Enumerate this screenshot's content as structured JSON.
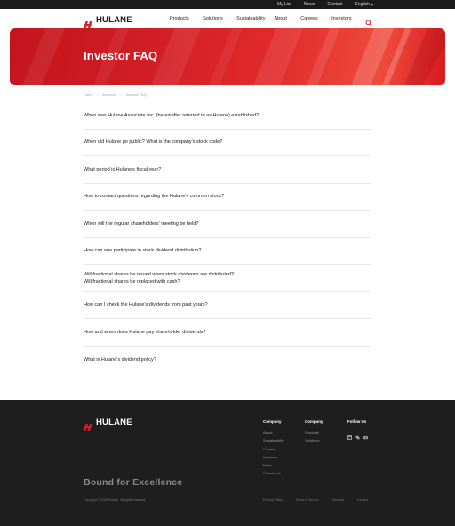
{
  "topbar": {
    "links": [
      "My List",
      "News",
      "Contact"
    ],
    "language": "English"
  },
  "brand": {
    "name": "HULANE",
    "accent": "#d31f25"
  },
  "nav": {
    "items": [
      {
        "label": "Products",
        "has_dropdown": true
      },
      {
        "label": "Solutions",
        "has_dropdown": true
      },
      {
        "label": "Sustainability",
        "has_dropdown": false
      },
      {
        "label": "About",
        "has_dropdown": true
      },
      {
        "label": "Careers",
        "has_dropdown": true
      },
      {
        "label": "Investors",
        "has_dropdown": true
      }
    ],
    "search_icon": "search-icon"
  },
  "hero": {
    "title": "Investor FAQ"
  },
  "breadcrumb": [
    "Home",
    "Investors",
    "Investor FAQ"
  ],
  "faq": [
    "When was Hulane Associate Inc. (hereinafter referred to as Hulane) established?",
    "When did Hulane go public? What is the company's stock code?",
    "What period is Hulane's fiscal year?",
    "How to contact questions regarding the Hulane's common stock?",
    "When will the regular shareholders' meeting be held?",
    "How can one participate in stock dividend distribution?",
    "Will fractional shares be issued when stock dividends are distributed?\nWill fractional shares be replaced with cash?",
    "How can I check the Hulane's dividends from past years?",
    "How and when does Hulane pay shareholder dividends?",
    "What is Hulane's dividend policy?"
  ],
  "footer": {
    "col1": {
      "title": "Company",
      "links": [
        "About",
        "Sustainability",
        "Careers",
        "Investors",
        "News",
        "Contact Us"
      ]
    },
    "col2": {
      "title": "Company",
      "links": [
        "Products",
        "Solutions"
      ]
    },
    "col3": {
      "title": "Follow Us",
      "icons": [
        "linkedin-icon",
        "wechat-icon",
        "youtube-icon"
      ]
    },
    "tagline": "Bound for Excellence",
    "copyright": "Copyright © 2023 Hulane. All rights reserved.",
    "legal": [
      "Privacy Policy",
      "Terms of Service",
      "Sitemap",
      "Cookies"
    ]
  }
}
